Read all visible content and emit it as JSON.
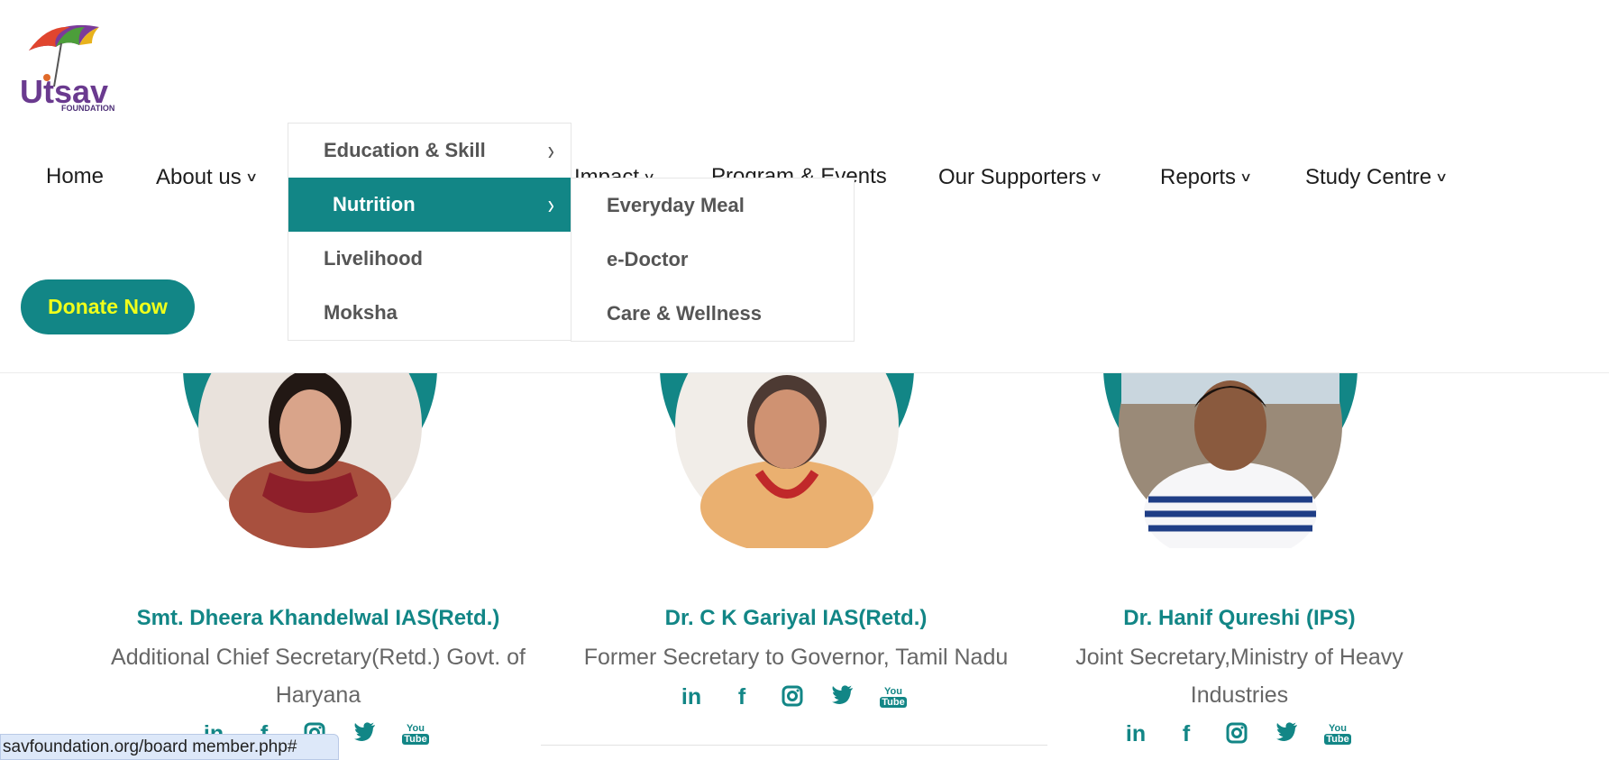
{
  "logo": {
    "text": "Utsav",
    "subtext": "FOUNDATION"
  },
  "nav": {
    "home": "Home",
    "about": "About us",
    "impact": "Impact",
    "programs": "Program & Events",
    "supporters": "Our Supporters",
    "reports": "Reports",
    "study": "Study Centre"
  },
  "donate_label": "Donate Now",
  "dropdown": {
    "items": [
      "Education & Skill",
      "Nutrition",
      "Livelihood",
      "Moksha"
    ],
    "active_index": 1,
    "submenu": [
      "Everyday Meal",
      "e-Doctor",
      "Care & Wellness"
    ]
  },
  "members": [
    {
      "name": "Smt. Dheera Khandelwal IAS(Retd.)",
      "role_line1": "Additional Chief Secretary(Retd.) Govt. of",
      "role_line2": "Haryana"
    },
    {
      "name": "Dr. C K Gariyal IAS(Retd.)",
      "role_line1": "Former Secretary to Governor, Tamil Nadu",
      "role_line2": ""
    },
    {
      "name": "Dr. Hanif Qureshi (IPS)",
      "role_line1": "Joint Secretary,Ministry of Heavy",
      "role_line2": "Industries"
    }
  ],
  "social_icons": [
    "linkedin-icon",
    "facebook-icon",
    "instagram-icon",
    "twitter-icon",
    "youtube-icon"
  ],
  "social_glyphs": {
    "linkedin": "in",
    "facebook": "f",
    "youtube_top": "You",
    "youtube_bottom": "Tube"
  },
  "status_url": "savfoundation.org/board member.php#",
  "colors": {
    "teal": "#128686",
    "donate_text": "#f0ff1a",
    "text": "#1d1d1d",
    "muted": "#666666"
  }
}
